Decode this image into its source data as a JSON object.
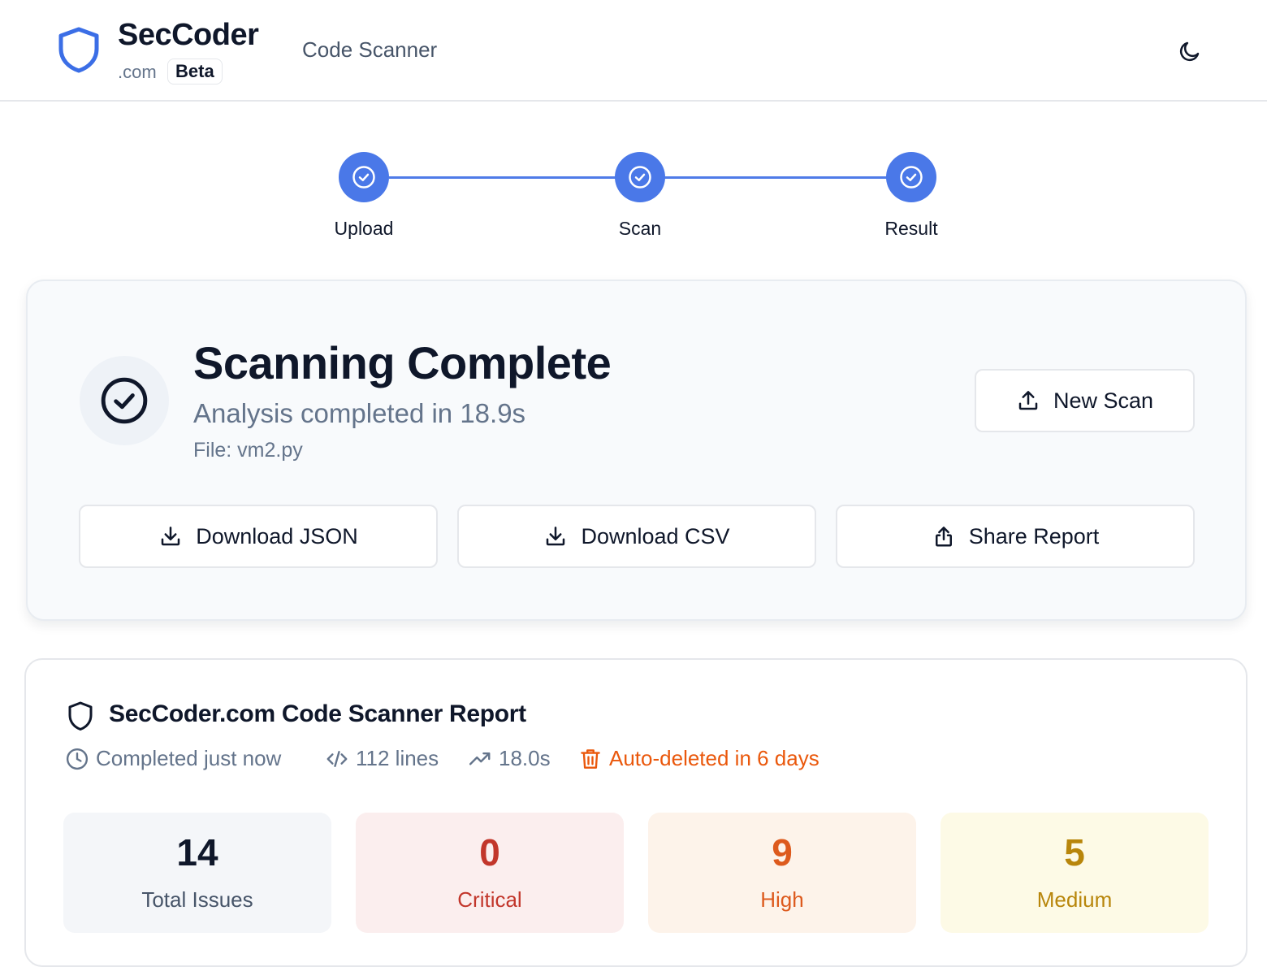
{
  "header": {
    "brand_name": "SecCoder",
    "brand_domain": ".com",
    "beta_badge": "Beta",
    "nav_title": "Code Scanner",
    "logo_icon": "shield-icon",
    "theme_icon": "moon-icon"
  },
  "stepper": {
    "steps": [
      {
        "label": "Upload",
        "status": "complete"
      },
      {
        "label": "Scan",
        "status": "complete"
      },
      {
        "label": "Result",
        "status": "complete"
      }
    ],
    "accent_color": "#4a78e8"
  },
  "result": {
    "title": "Scanning Complete",
    "subtitle": "Analysis completed in 18.9s",
    "file": "File: vm2.py",
    "new_scan_label": "New Scan",
    "actions": [
      {
        "label": "Download JSON",
        "icon": "download-icon"
      },
      {
        "label": "Download CSV",
        "icon": "download-icon"
      },
      {
        "label": "Share Report",
        "icon": "share-icon"
      }
    ]
  },
  "report": {
    "title": "SecCoder.com Code Scanner Report",
    "meta": {
      "completed": "Completed just now",
      "lines": "112 lines",
      "duration": "18.0s",
      "auto_delete": "Auto-deleted in 6 days"
    },
    "stats": [
      {
        "value": "14",
        "label": "Total Issues",
        "color": "#0f172a",
        "label_color": "#475569",
        "bg": "#f4f6f9"
      },
      {
        "value": "0",
        "label": "Critical",
        "color": "#c2362b",
        "label_color": "#c2362b",
        "bg": "#fbeeee"
      },
      {
        "value": "9",
        "label": "High",
        "color": "#dd5a1d",
        "label_color": "#dd5a1d",
        "bg": "#fdf3ea"
      },
      {
        "value": "5",
        "label": "Medium",
        "color": "#b8860b",
        "label_color": "#b8860b",
        "bg": "#fdfae6"
      }
    ]
  }
}
